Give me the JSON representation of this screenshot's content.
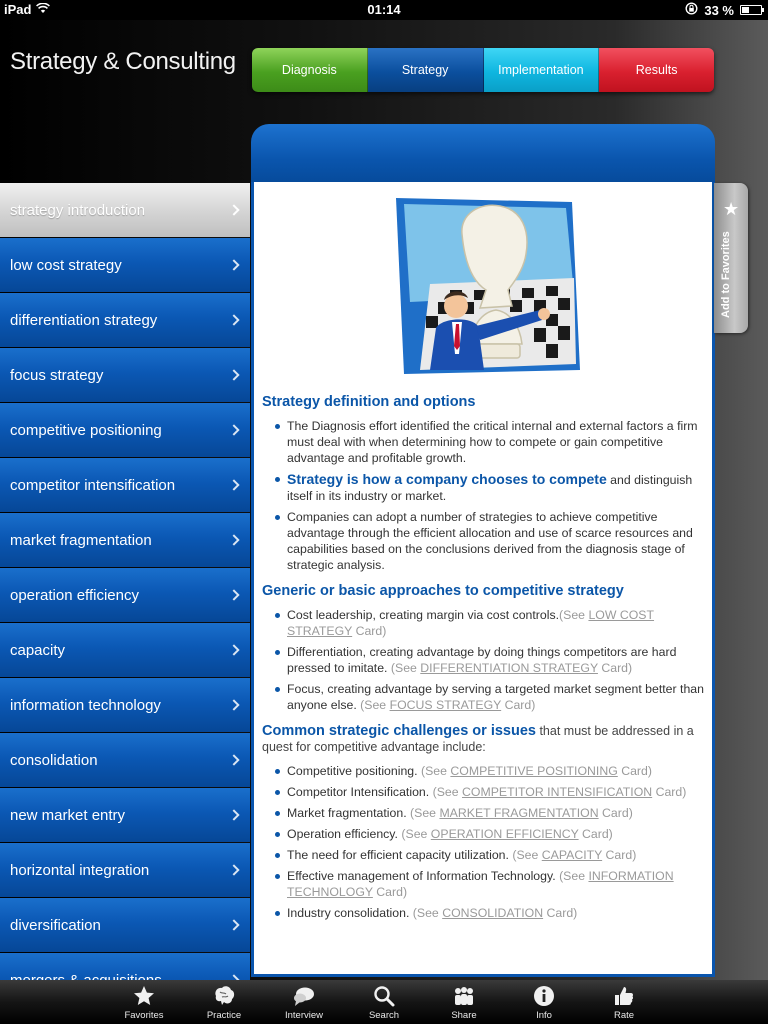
{
  "status_bar": {
    "device": "iPad",
    "time": "01:14",
    "battery": "33 %",
    "battery_level": 0.33
  },
  "app": {
    "title": "Strategy & Consulting"
  },
  "tabs": [
    {
      "label": "Diagnosis"
    },
    {
      "label": "Strategy"
    },
    {
      "label": "Implementation"
    },
    {
      "label": "Results"
    }
  ],
  "sidebar": {
    "items": [
      {
        "label": "strategy introduction"
      },
      {
        "label": "low cost strategy"
      },
      {
        "label": "differentiation strategy"
      },
      {
        "label": "focus strategy"
      },
      {
        "label": "competitive positioning"
      },
      {
        "label": "competitor intensification"
      },
      {
        "label": "market fragmentation"
      },
      {
        "label": "operation efficiency"
      },
      {
        "label": "capacity"
      },
      {
        "label": "information technology"
      },
      {
        "label": "consolidation"
      },
      {
        "label": "new market entry"
      },
      {
        "label": "horizontal integration"
      },
      {
        "label": "diversification"
      },
      {
        "label": "mergers & acquisitions"
      }
    ]
  },
  "favorites_tab": {
    "label": "Add to Favorites"
  },
  "content": {
    "section1": {
      "title": "Strategy definition and options",
      "b1": "The Diagnosis effort identified the critical internal and external factors a firm must deal with when determining how to compete or gain competitive advantage and profitable growth.",
      "b2_highlight": "Strategy is how a company chooses to compete",
      "b2_rest": " and distinguish itself in its industry or market.",
      "b3": "Companies can adopt a number of strategies to achieve competitive advantage through the efficient allocation and use of scarce resources and capabilities based on the conclusions derived from the diagnosis stage of strategic analysis."
    },
    "section2": {
      "title": "Generic or basic approaches to competitive strategy",
      "b1_text": "Cost leadership, creating margin via cost controls.",
      "b1_see": "(See ",
      "b1_link": "LOW COST STRATEGY",
      "b1_card": " Card)",
      "b2_text": "Differentiation, creating advantage by doing things competitors are hard pressed to imitate. ",
      "b2_see": "(See ",
      "b2_link": "DIFFERENTIATION STRATEGY",
      "b2_card": " Card)",
      "b3_text": "Focus, creating advantage by serving a targeted market segment better than anyone else. ",
      "b3_see": "(See ",
      "b3_link": "FOCUS STRATEGY",
      "b3_card": " Card)"
    },
    "section3": {
      "title": "Common strategic challenges or issues",
      "title_rest": " that must be addressed in a quest for competitive advantage include:",
      "items": [
        {
          "text": "Competitive positioning. ",
          "see": "(See ",
          "link": "COMPETITIVE POSITIONING",
          "card": " Card)"
        },
        {
          "text": "Competitor Intensification. ",
          "see": "(See ",
          "link": "COMPETITOR INTENSIFICATION",
          "card": " Card)"
        },
        {
          "text": "Market fragmentation. ",
          "see": "(See ",
          "link": "MARKET FRAGMENTATION",
          "card": " Card)"
        },
        {
          "text": "Operation efficiency. ",
          "see": "(See ",
          "link": "OPERATION EFFICIENCY",
          "card": " Card)"
        },
        {
          "text": "The need for efficient capacity utilization. ",
          "see": "(See ",
          "link": "CAPACITY",
          "card": " Card)"
        },
        {
          "text": "Effective management of Information Technology. ",
          "see": "(See ",
          "link": "INFORMATION TECHNOLOGY",
          "card": " Card)"
        },
        {
          "text": "Industry consolidation. ",
          "see": "(See ",
          "link": "CONSOLIDATION",
          "card": " Card)"
        }
      ]
    }
  },
  "tabbar": [
    {
      "label": "Favorites",
      "icon": "star-icon"
    },
    {
      "label": "Practice",
      "icon": "brain-icon"
    },
    {
      "label": "Interview",
      "icon": "speech-bubble-icon"
    },
    {
      "label": "Search",
      "icon": "search-icon"
    },
    {
      "label": "Share",
      "icon": "people-icon"
    },
    {
      "label": "Info",
      "icon": "info-icon"
    },
    {
      "label": "Rate",
      "icon": "thumbs-up-icon"
    }
  ]
}
